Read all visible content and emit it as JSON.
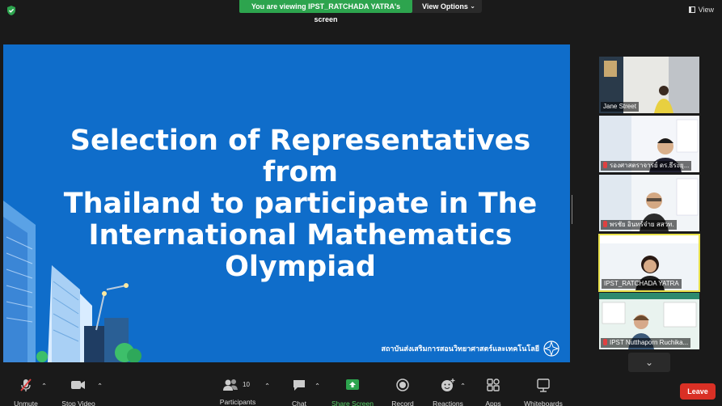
{
  "top": {
    "viewing_banner": "You are viewing IPST_RATCHADA YATRA's screen",
    "view_options": "View Options",
    "view_label": "View"
  },
  "slide": {
    "title_lines": [
      "Selection of Representatives from",
      "Thailand to participate in The",
      "International Mathematics",
      "Olympiad"
    ],
    "footer_org": "สถาบันส่งเสริมการสอนวิทยาศาสตร์และเทคโนโลยี"
  },
  "participants": [
    {
      "name": "Jane Street",
      "muted": false
    },
    {
      "name": "รองศาสตราจารย์ ดร.ธีระยุ...",
      "muted": true
    },
    {
      "name": "พรชัย อินทร์จ๋าย สสวท.",
      "muted": true
    },
    {
      "name": "IPST_RATCHADA YATRA",
      "muted": false,
      "active": true
    },
    {
      "name": "IPST Nutthaporn Ruchika...",
      "muted": true
    }
  ],
  "toolbar": {
    "unmute": "Unmute",
    "stop_video": "Stop Video",
    "participants": "Participants",
    "participants_count": "10",
    "chat": "Chat",
    "share_screen": "Share Screen",
    "record": "Record",
    "reactions": "Reactions",
    "apps": "Apps",
    "whiteboards": "Whiteboards",
    "leave": "Leave"
  },
  "colors": {
    "slide_bg": "#0f6dca",
    "banner_green": "#2da44e",
    "active_border": "#e8e049",
    "leave_red": "#d93025",
    "share_green": "#5bd26b"
  }
}
